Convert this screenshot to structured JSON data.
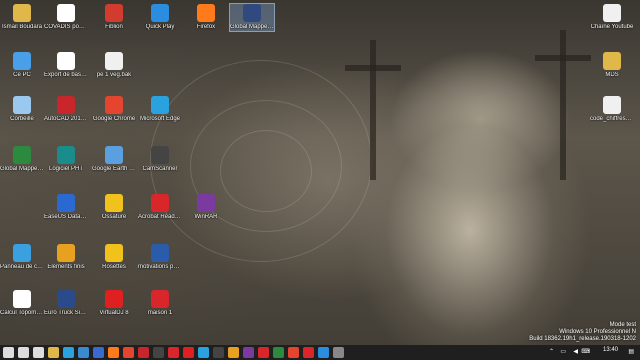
{
  "desktop_icons": [
    {
      "label": "Ismail Boudara",
      "icon": "folder-icon",
      "color": "#e0b84a"
    },
    {
      "label": "COVADIS pour AutoCAD 201...",
      "icon": "covadis-icon",
      "color": "#ffffff"
    },
    {
      "label": "Fiblion",
      "icon": "fiblion-icon",
      "color": "#d23b2e"
    },
    {
      "label": "Quick Play",
      "icon": "quickplay-icon",
      "color": "#2a8de0"
    },
    {
      "label": "Firefox",
      "icon": "firefox-icon",
      "color": "#ff7a1a"
    },
    {
      "label": "Global Mapper 18",
      "icon": "globalmapper-icon",
      "color": "#304a80"
    },
    {
      "label": "Ce PC",
      "icon": "computer-icon",
      "color": "#4aa0e8"
    },
    {
      "label": "Export de base d'Articles",
      "icon": "covadis-icon",
      "color": "#ffffff"
    },
    {
      "label": "pe 1 veg.bak",
      "icon": "file-icon",
      "color": "#f0f0f0"
    },
    {
      "label": "Corbeille",
      "icon": "recycle-bin-icon",
      "color": "#9ac8ee"
    },
    {
      "label": "AutoCAD 2018 - Français (Fr...",
      "icon": "autocad-icon",
      "color": "#c8262a"
    },
    {
      "label": "Google Chrome",
      "icon": "chrome-icon",
      "color": "#e5442e"
    },
    {
      "label": "Microsoft Edge",
      "icon": "edge-icon",
      "color": "#2aa2e0"
    },
    {
      "label": "Global Mapper 18 (64-bit)",
      "icon": "globalmapper-icon",
      "color": "#2c8a3e"
    },
    {
      "label": "Logiciel PHT",
      "icon": "pht-icon",
      "color": "#1a8c8c"
    },
    {
      "label": "Google Earth Pro",
      "icon": "globe-icon",
      "color": "#5aa0e0"
    },
    {
      "label": "CamScanner",
      "icon": "camscanner-icon",
      "color": "#444444"
    },
    {
      "label": "EaseUS Data Recovery Wizard",
      "icon": "easeus-icon",
      "color": "#2a6ad0"
    },
    {
      "label": "Ossature",
      "icon": "ossature-icon",
      "color": "#f2c21c"
    },
    {
      "label": "Acrobat Reader DC",
      "icon": "pdf-icon",
      "color": "#d8262a"
    },
    {
      "label": "WinRAR",
      "icon": "winrar-icon",
      "color": "#7a3aa0"
    },
    {
      "label": "Panneau de configuration",
      "icon": "control-panel-icon",
      "color": "#3aa0e0"
    },
    {
      "label": "Éléments finis",
      "icon": "elements-icon",
      "color": "#e8a020"
    },
    {
      "label": "Rosettes",
      "icon": "rosettes-icon",
      "color": "#f2c21c"
    },
    {
      "label": "motivations pour métier...",
      "icon": "word-icon",
      "color": "#2b5cab"
    },
    {
      "label": "Calcul Topométrique",
      "icon": "calcul-icon",
      "color": "#ffffff"
    },
    {
      "label": "Euro Truck Simulator 2",
      "icon": "truck-icon",
      "color": "#2a4a8a"
    },
    {
      "label": "VirtualDJ 8",
      "icon": "virtualdj-icon",
      "color": "#e02020"
    },
    {
      "label": "maison 1",
      "icon": "pdf-icon",
      "color": "#d8262a"
    },
    {
      "label": "Chaîne Youtube",
      "icon": "file-icon",
      "color": "#f0f0f0"
    },
    {
      "label": "MDS",
      "icon": "folder-icon",
      "color": "#e0b84a"
    },
    {
      "label": "code_chiffres_e...",
      "icon": "file-icon",
      "color": "#f0f0f0"
    }
  ],
  "watermark": {
    "line1": "Mode test",
    "line2": "Windows 10 Professionnel N",
    "line3": "Build 18362.19h1_release.190318-1202"
  },
  "taskbar": {
    "apps": [
      {
        "name": "start-button",
        "icon": "windows-icon",
        "color": "#ffffff"
      },
      {
        "name": "search-button",
        "icon": "search-icon",
        "color": "#ffffff"
      },
      {
        "name": "task-view-button",
        "icon": "task-view-icon",
        "color": "#ffffff"
      },
      {
        "name": "taskbar-explorer",
        "icon": "folder-icon",
        "color": "#e0b84a"
      },
      {
        "name": "taskbar-edge",
        "icon": "edge-icon",
        "color": "#2aa2e0"
      },
      {
        "name": "taskbar-store",
        "icon": "store-icon",
        "color": "#3a8ad0"
      },
      {
        "name": "taskbar-mail",
        "icon": "mail-icon",
        "color": "#3a6ad0"
      },
      {
        "name": "taskbar-firefox",
        "icon": "firefox-icon",
        "color": "#ff7a1a"
      },
      {
        "name": "taskbar-chrome",
        "icon": "chrome-icon",
        "color": "#e5442e"
      },
      {
        "name": "taskbar-autocad",
        "icon": "autocad-icon",
        "color": "#c8262a"
      },
      {
        "name": "taskbar-app-1",
        "icon": "app-icon",
        "color": "#444444"
      },
      {
        "name": "taskbar-app-2",
        "icon": "app-icon",
        "color": "#d8262a"
      },
      {
        "name": "taskbar-app-3",
        "icon": "app-icon",
        "color": "#e02020"
      },
      {
        "name": "taskbar-app-4",
        "icon": "app-icon",
        "color": "#2aa2e0"
      },
      {
        "name": "taskbar-app-5",
        "icon": "app-icon",
        "color": "#444444"
      },
      {
        "name": "taskbar-app-6",
        "icon": "app-icon",
        "color": "#e8a020"
      },
      {
        "name": "taskbar-app-7",
        "icon": "app-icon",
        "color": "#7a3aa0"
      },
      {
        "name": "taskbar-app-8",
        "icon": "app-icon",
        "color": "#d8262a"
      },
      {
        "name": "taskbar-app-9",
        "icon": "app-icon",
        "color": "#2c8a3e"
      },
      {
        "name": "taskbar-app-10",
        "icon": "app-icon",
        "color": "#e5442e"
      },
      {
        "name": "taskbar-app-11",
        "icon": "app-icon",
        "color": "#d8262a"
      },
      {
        "name": "taskbar-app-12",
        "icon": "app-icon",
        "color": "#2a8de0"
      },
      {
        "name": "taskbar-app-13",
        "icon": "app-icon",
        "color": "#888888"
      }
    ],
    "tray_icons": [
      "chevron-up-icon",
      "network-icon",
      "volume-icon",
      "keyboard-icon"
    ],
    "clock_time": "13:40"
  }
}
